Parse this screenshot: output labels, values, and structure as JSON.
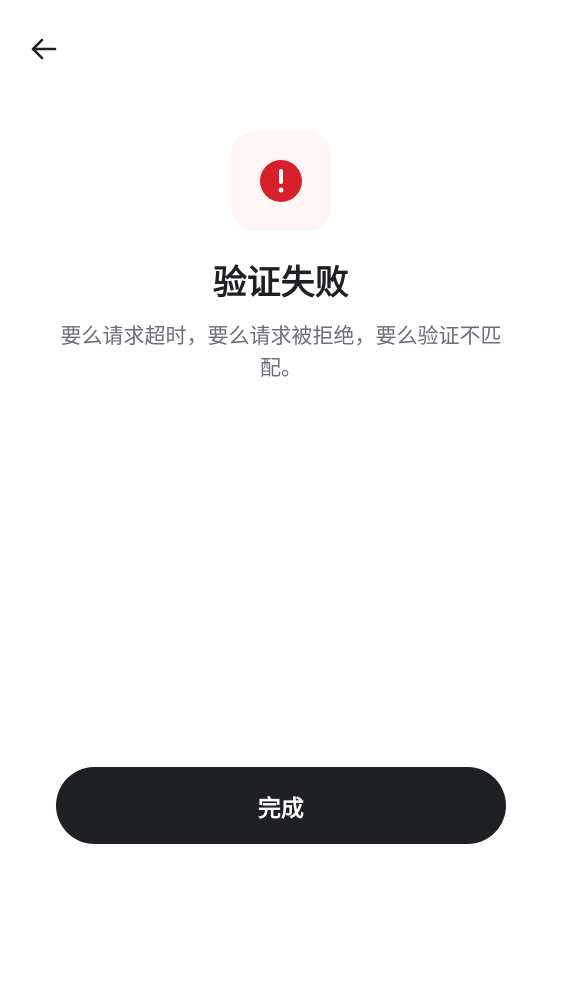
{
  "header": {
    "back_icon": "arrow-left-icon"
  },
  "status": {
    "icon": "exclamation-circle-icon",
    "icon_color": "#d81f2c",
    "tile_color": "#fff5f4"
  },
  "content": {
    "title": "验证失败",
    "message": "要么请求超时，要么请求被拒绝，要么验证不匹配。"
  },
  "actions": {
    "done_label": "完成",
    "button_color": "#1f2024"
  }
}
